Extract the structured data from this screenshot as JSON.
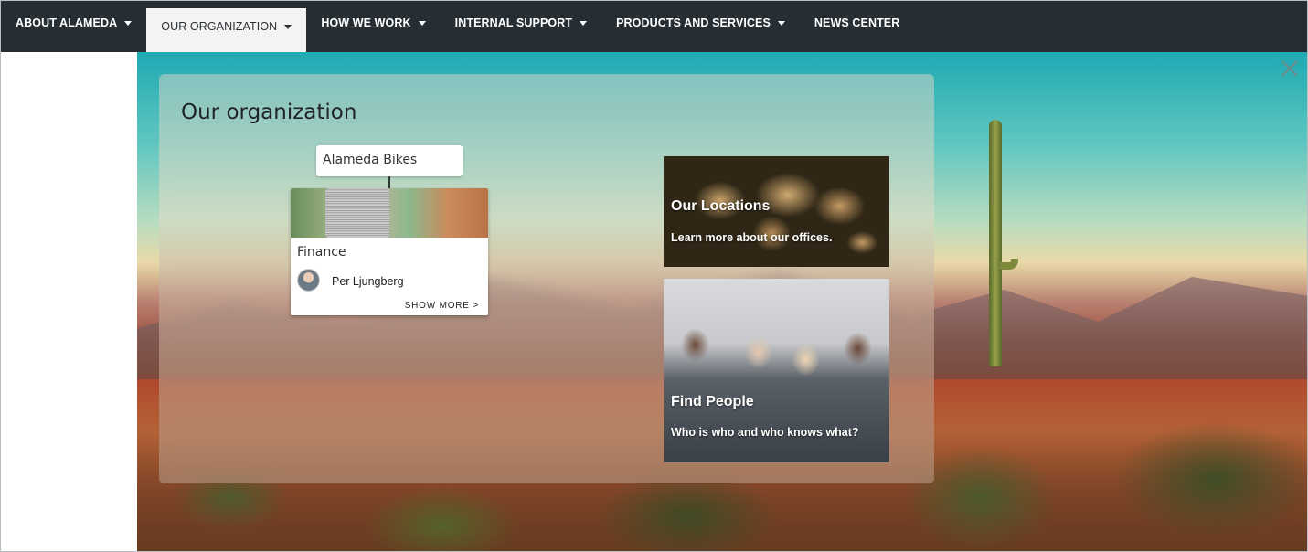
{
  "nav": {
    "items": [
      {
        "label": "ABOUT ALAMEDA",
        "has_caret": true
      },
      {
        "label": "OUR ORGANIZATION",
        "has_caret": true,
        "active": true
      },
      {
        "label": "HOW WE WORK",
        "has_caret": true
      },
      {
        "label": "INTERNAL SUPPORT",
        "has_caret": true
      },
      {
        "label": "PRODUCTS AND SERVICES",
        "has_caret": true
      },
      {
        "label": "NEWS CENTER",
        "has_caret": false
      }
    ]
  },
  "panel": {
    "title": "Our organization",
    "org": {
      "root_label": "Alameda Bikes",
      "card_name": "Finance",
      "person_name": "Per Ljungberg",
      "show_more": "SHOW MORE >"
    },
    "tiles": {
      "locations": {
        "title": "Our Locations",
        "subtitle": "Learn more about our offices."
      },
      "people": {
        "title": "Find People",
        "subtitle": "Who is who and who knows what?"
      }
    }
  },
  "icons": {
    "close": "close-icon",
    "caret": "caret-down-icon"
  },
  "colors": {
    "nav_bg": "#262e34",
    "nav_active_bg": "#f3f3f3",
    "nav_text": "#ffffff"
  }
}
